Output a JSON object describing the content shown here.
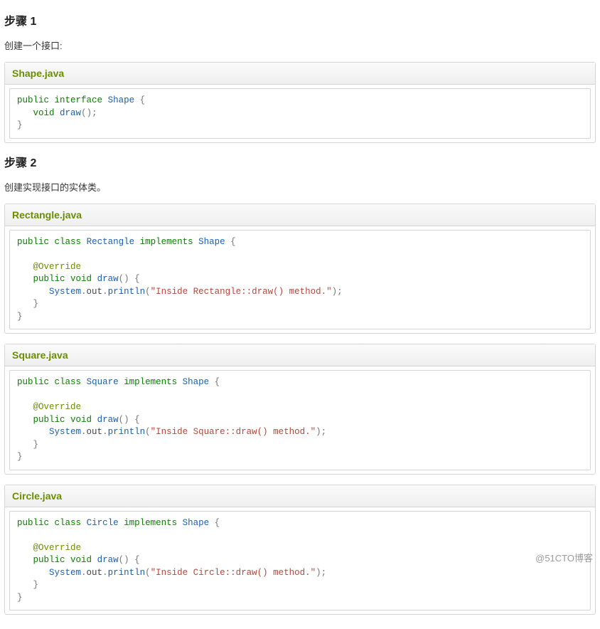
{
  "steps": [
    {
      "heading": "步骤 1",
      "desc": "创建一个接口:",
      "files": [
        {
          "title": "Shape.java",
          "code_tokens": [
            [
              [
                "k-pub",
                "public"
              ],
              [
                "",
                " "
              ],
              [
                "k-pub",
                "interface"
              ],
              [
                "",
                " "
              ],
              [
                "k-type",
                "Shape"
              ],
              [
                "",
                " "
              ],
              [
                "brace",
                "{"
              ]
            ],
            [
              [
                "",
                "   "
              ],
              [
                "k-pub",
                "void"
              ],
              [
                "",
                " "
              ],
              [
                "k-fn",
                "draw"
              ],
              [
                "paren",
                "()"
              ],
              [
                "semi",
                ";"
              ]
            ],
            [
              [
                "brace",
                "}"
              ]
            ]
          ]
        }
      ]
    },
    {
      "heading": "步骤 2",
      "desc": "创建实现接口的实体类。",
      "files": [
        {
          "title": "Rectangle.java",
          "code_tokens": [
            [
              [
                "k-pub",
                "public"
              ],
              [
                "",
                " "
              ],
              [
                "k-pub",
                "class"
              ],
              [
                "",
                " "
              ],
              [
                "k-type",
                "Rectangle"
              ],
              [
                "",
                " "
              ],
              [
                "k-pub",
                "implements"
              ],
              [
                "",
                " "
              ],
              [
                "k-type",
                "Shape"
              ],
              [
                "",
                " "
              ],
              [
                "brace",
                "{"
              ]
            ],
            [
              [
                "",
                ""
              ]
            ],
            [
              [
                "",
                "   "
              ],
              [
                "k-anno",
                "@Override"
              ]
            ],
            [
              [
                "",
                "   "
              ],
              [
                "k-pub",
                "public"
              ],
              [
                "",
                " "
              ],
              [
                "k-pub",
                "void"
              ],
              [
                "",
                " "
              ],
              [
                "k-fn",
                "draw"
              ],
              [
                "paren",
                "()"
              ],
              [
                "",
                " "
              ],
              [
                "brace",
                "{"
              ]
            ],
            [
              [
                "",
                "      "
              ],
              [
                "k-type",
                "System"
              ],
              [
                "dot",
                "."
              ],
              [
                "k-prop",
                "out"
              ],
              [
                "dot",
                "."
              ],
              [
                "k-fn",
                "println"
              ],
              [
                "paren",
                "("
              ],
              [
                "str",
                "\"Inside Rectangle::draw() method.\""
              ],
              [
                "paren",
                ")"
              ],
              [
                "semi",
                ";"
              ]
            ],
            [
              [
                "",
                "   "
              ],
              [
                "brace",
                "}"
              ]
            ],
            [
              [
                "brace",
                "}"
              ]
            ]
          ]
        },
        {
          "title": "Square.java",
          "code_tokens": [
            [
              [
                "k-pub",
                "public"
              ],
              [
                "",
                " "
              ],
              [
                "k-pub",
                "class"
              ],
              [
                "",
                " "
              ],
              [
                "k-type",
                "Square"
              ],
              [
                "",
                " "
              ],
              [
                "k-pub",
                "implements"
              ],
              [
                "",
                " "
              ],
              [
                "k-type",
                "Shape"
              ],
              [
                "",
                " "
              ],
              [
                "brace",
                "{"
              ]
            ],
            [
              [
                "",
                ""
              ]
            ],
            [
              [
                "",
                "   "
              ],
              [
                "k-anno",
                "@Override"
              ]
            ],
            [
              [
                "",
                "   "
              ],
              [
                "k-pub",
                "public"
              ],
              [
                "",
                " "
              ],
              [
                "k-pub",
                "void"
              ],
              [
                "",
                " "
              ],
              [
                "k-fn",
                "draw"
              ],
              [
                "paren",
                "()"
              ],
              [
                "",
                " "
              ],
              [
                "brace",
                "{"
              ]
            ],
            [
              [
                "",
                "      "
              ],
              [
                "k-type",
                "System"
              ],
              [
                "dot",
                "."
              ],
              [
                "k-prop",
                "out"
              ],
              [
                "dot",
                "."
              ],
              [
                "k-fn",
                "println"
              ],
              [
                "paren",
                "("
              ],
              [
                "str",
                "\"Inside Square::draw() method.\""
              ],
              [
                "paren",
                ")"
              ],
              [
                "semi",
                ";"
              ]
            ],
            [
              [
                "",
                "   "
              ],
              [
                "brace",
                "}"
              ]
            ],
            [
              [
                "brace",
                "}"
              ]
            ]
          ]
        },
        {
          "title": "Circle.java",
          "code_tokens": [
            [
              [
                "k-pub",
                "public"
              ],
              [
                "",
                " "
              ],
              [
                "k-pub",
                "class"
              ],
              [
                "",
                " "
              ],
              [
                "k-type",
                "Circle"
              ],
              [
                "",
                " "
              ],
              [
                "k-pub",
                "implements"
              ],
              [
                "",
                " "
              ],
              [
                "k-type",
                "Shape"
              ],
              [
                "",
                " "
              ],
              [
                "brace",
                "{"
              ]
            ],
            [
              [
                "",
                ""
              ]
            ],
            [
              [
                "",
                "   "
              ],
              [
                "k-anno",
                "@Override"
              ]
            ],
            [
              [
                "",
                "   "
              ],
              [
                "k-pub",
                "public"
              ],
              [
                "",
                " "
              ],
              [
                "k-pub",
                "void"
              ],
              [
                "",
                " "
              ],
              [
                "k-fn",
                "draw"
              ],
              [
                "paren",
                "()"
              ],
              [
                "",
                " "
              ],
              [
                "brace",
                "{"
              ]
            ],
            [
              [
                "",
                "      "
              ],
              [
                "k-type",
                "System"
              ],
              [
                "dot",
                "."
              ],
              [
                "k-prop",
                "out"
              ],
              [
                "dot",
                "."
              ],
              [
                "k-fn",
                "println"
              ],
              [
                "paren",
                "("
              ],
              [
                "str",
                "\"Inside Circle::draw() method.\""
              ],
              [
                "paren",
                ")"
              ],
              [
                "semi",
                ";"
              ]
            ],
            [
              [
                "",
                "   "
              ],
              [
                "brace",
                "}"
              ]
            ],
            [
              [
                "brace",
                "}"
              ]
            ]
          ]
        }
      ]
    }
  ],
  "watermark": "@51CTO博客"
}
